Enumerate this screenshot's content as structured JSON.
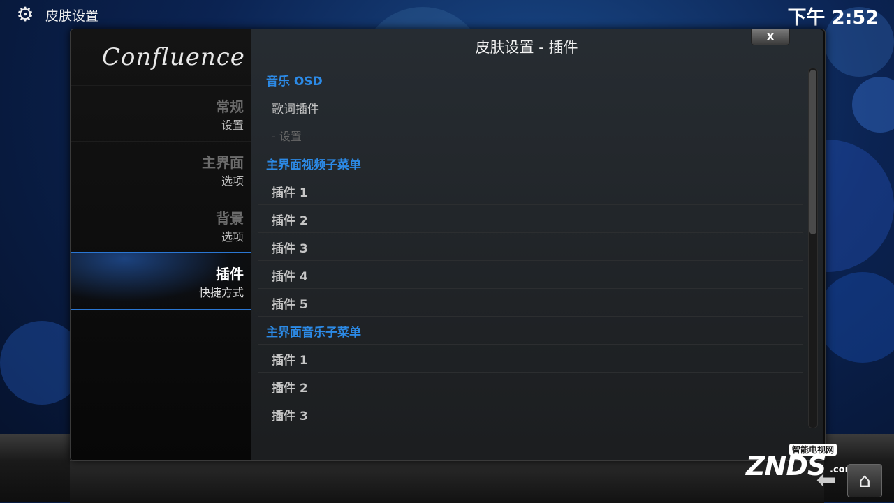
{
  "topbar": {
    "icon": "gear-icon",
    "title": "皮肤设置",
    "clock": "下午 2:52"
  },
  "sidebar": {
    "logo": "Confluence",
    "items": [
      {
        "title": "常规",
        "subtitle": "设置",
        "active": false
      },
      {
        "title": "主界面",
        "subtitle": "选项",
        "active": false
      },
      {
        "title": "背景",
        "subtitle": "选项",
        "active": false
      },
      {
        "title": "插件",
        "subtitle": "快捷方式",
        "active": true
      }
    ]
  },
  "dialog": {
    "title": "皮肤设置 - 插件",
    "close_label": "x"
  },
  "list": {
    "rows": [
      {
        "type": "header",
        "label": "音乐 OSD"
      },
      {
        "type": "plain",
        "label": "歌词插件"
      },
      {
        "type": "sub",
        "label": "- 设置"
      },
      {
        "type": "header",
        "label": "主界面视频子菜单"
      },
      {
        "type": "item",
        "label": "插件 1"
      },
      {
        "type": "item",
        "label": "插件 2"
      },
      {
        "type": "item",
        "label": "插件 3"
      },
      {
        "type": "item",
        "label": "插件 4"
      },
      {
        "type": "item",
        "label": "插件 5"
      },
      {
        "type": "header",
        "label": "主界面音乐子菜单"
      },
      {
        "type": "item",
        "label": "插件 1"
      },
      {
        "type": "item",
        "label": "插件 2"
      },
      {
        "type": "item",
        "label": "插件 3"
      }
    ]
  },
  "watermark": {
    "top_text": "智能电视网",
    "logo": "ZNDS",
    "suffix": ".com"
  },
  "nav": {
    "back_icon": "back-arrow-icon",
    "home_icon": "home-icon"
  }
}
